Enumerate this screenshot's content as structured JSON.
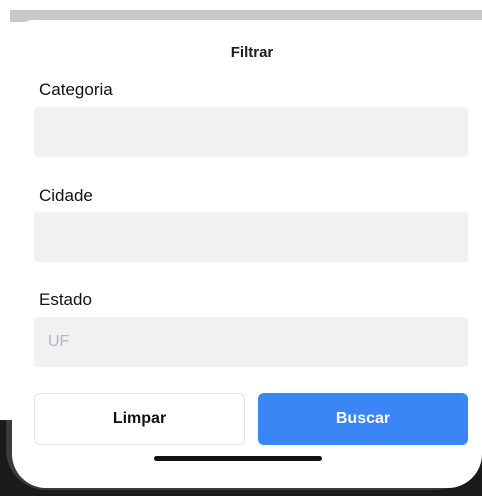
{
  "sheet": {
    "title": "Filtrar"
  },
  "fields": {
    "category": {
      "label": "Categoria",
      "value": "",
      "placeholder": ""
    },
    "city": {
      "label": "Cidade",
      "value": "",
      "placeholder": ""
    },
    "state": {
      "label": "Estado",
      "value": "",
      "placeholder": "UF"
    }
  },
  "actions": {
    "clear_label": "Limpar",
    "search_label": "Buscar"
  },
  "colors": {
    "accent": "#3a86f7",
    "input_background": "#eff1f2"
  }
}
